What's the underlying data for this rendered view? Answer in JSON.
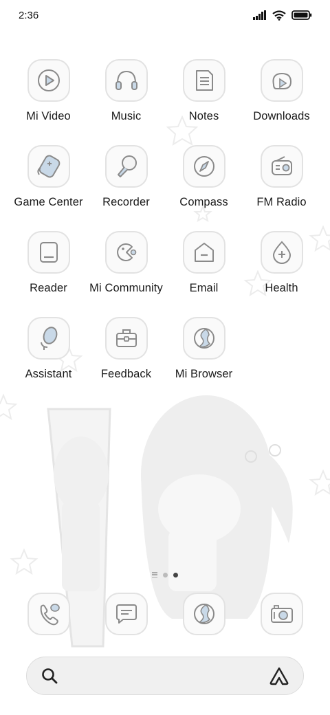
{
  "status_bar": {
    "time": "2:36",
    "icons": [
      "signal-icon",
      "wifi-icon",
      "battery-icon"
    ]
  },
  "apps": [
    {
      "label": "Mi Video",
      "icon": "mi-video-icon"
    },
    {
      "label": "Music",
      "icon": "music-icon"
    },
    {
      "label": "Notes",
      "icon": "notes-icon"
    },
    {
      "label": "Downloads",
      "icon": "downloads-icon"
    },
    {
      "label": "Game Center",
      "icon": "game-center-icon"
    },
    {
      "label": "Recorder",
      "icon": "recorder-icon"
    },
    {
      "label": "Compass",
      "icon": "compass-icon"
    },
    {
      "label": "FM Radio",
      "icon": "fm-radio-icon"
    },
    {
      "label": "Reader",
      "icon": "reader-icon"
    },
    {
      "label": "Mi Community",
      "icon": "mi-community-icon"
    },
    {
      "label": "Email",
      "icon": "email-icon"
    },
    {
      "label": "Health",
      "icon": "health-icon"
    },
    {
      "label": "Assistant",
      "icon": "assistant-icon"
    },
    {
      "label": "Feedback",
      "icon": "feedback-icon"
    },
    {
      "label": "Mi Browser",
      "icon": "mi-browser-icon"
    }
  ],
  "pager": {
    "pages": 2,
    "active_page": 2
  },
  "dock": [
    {
      "icon": "phone-icon"
    },
    {
      "icon": "messages-icon"
    },
    {
      "icon": "browser-icon"
    },
    {
      "icon": "camera-icon"
    }
  ],
  "search": {
    "left_icon": "search-icon",
    "right_icon": "assistant-triangle-icon"
  },
  "colors": {
    "icon_outline": "#8a8a8a",
    "icon_accent": "#c9d9e8",
    "tile_border": "#e2e2e2",
    "search_bg": "#f0f0f0"
  }
}
